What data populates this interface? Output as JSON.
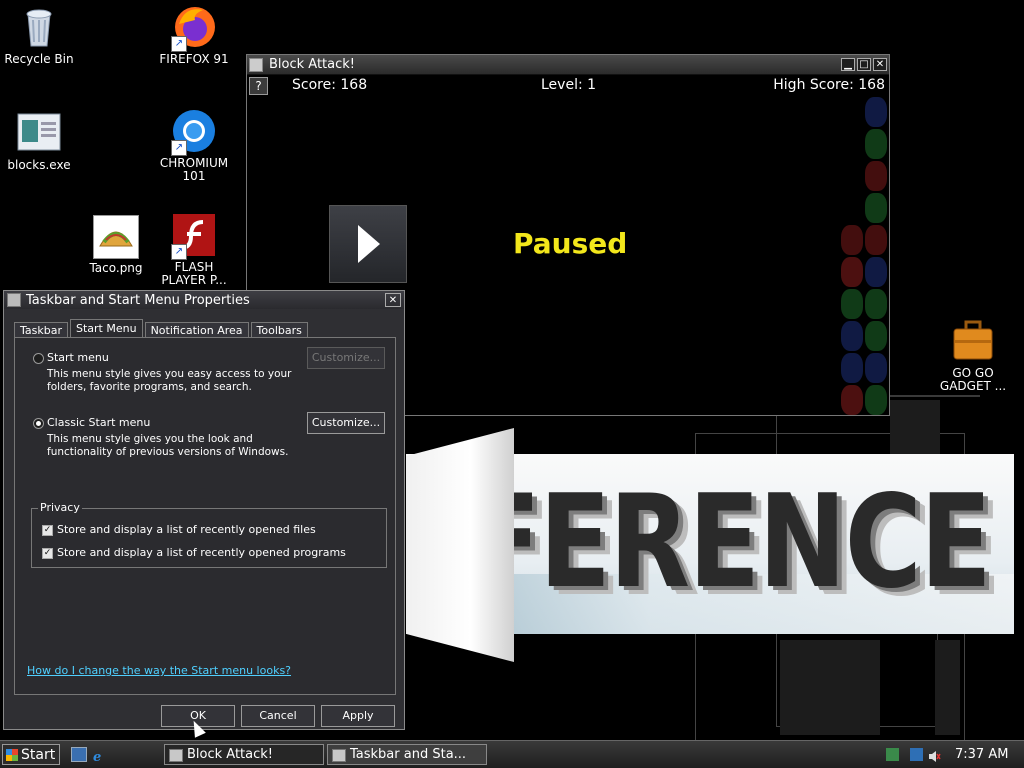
{
  "desktop": {
    "icons": [
      {
        "label": "Recycle Bin",
        "icon": "recycle-bin-icon"
      },
      {
        "label": "FIREFOX 91",
        "icon": "firefox-icon"
      },
      {
        "label": "blocks.exe",
        "icon": "blocks-exe-icon"
      },
      {
        "label": "CHROMIUM 101",
        "icon": "chromium-icon"
      },
      {
        "label": "Taco.png",
        "icon": "taco-image-icon"
      },
      {
        "label": "FLASH PLAYER P...",
        "icon": "flash-player-icon"
      },
      {
        "label": "GO GO GADGET ...",
        "icon": "briefcase-icon"
      }
    ],
    "wallpaper_text": "RFERENCE"
  },
  "block_attack": {
    "title": "Block Attack!",
    "help_label": "?",
    "score": "Score: 168",
    "level": "Level: 1",
    "high_score": "High Score: 168",
    "paused": "Paused",
    "colors": {
      "paused": "#f3e71b"
    }
  },
  "dialog": {
    "title": "Taskbar and Start Menu Properties",
    "tabs": [
      "Taskbar",
      "Start Menu",
      "Notification Area",
      "Toolbars"
    ],
    "active_tab": "Start Menu",
    "start_menu": {
      "label": "Start menu",
      "description": "This menu style gives you easy access to your folders, favorite programs, and search.",
      "customize": "Customize..."
    },
    "classic_menu": {
      "label": "Classic Start menu",
      "description": "This menu style gives you the look and functionality of previous versions of Windows.",
      "customize": "Customize..."
    },
    "privacy": {
      "label": "Privacy",
      "files": "Store and display a list of recently opened files",
      "programs": "Store and display a list of recently opened programs"
    },
    "help_link": "How do I change the way the Start menu looks?",
    "ok": "OK",
    "cancel": "Cancel",
    "apply": "Apply"
  },
  "taskbar": {
    "start": "Start",
    "tasks": [
      "Block Attack!",
      "Taskbar and Sta..."
    ],
    "clock": "7:37 AM"
  }
}
